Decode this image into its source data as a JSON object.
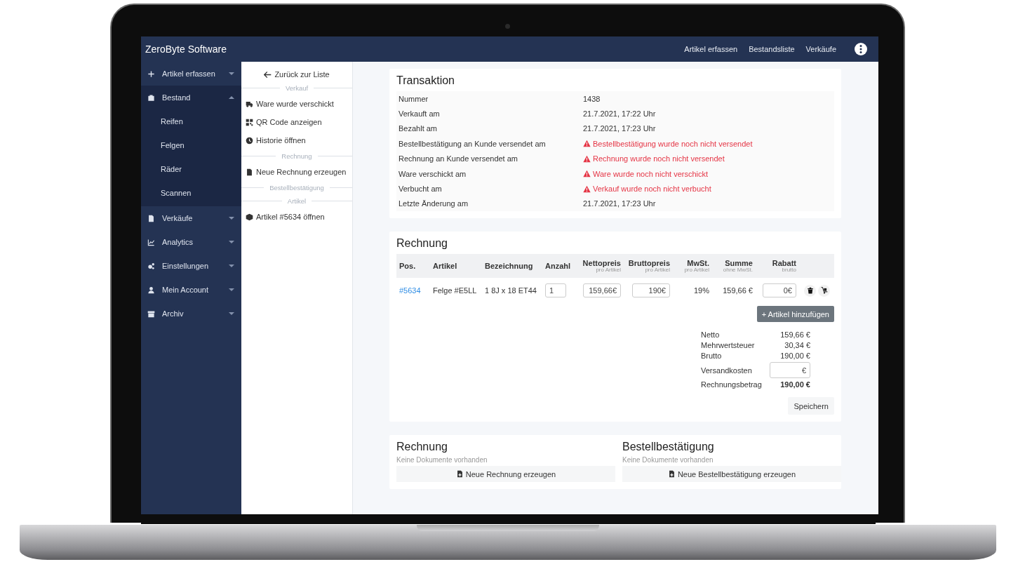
{
  "header": {
    "title": "ZeroByte Software",
    "nav": [
      "Artikel erfassen",
      "Bestandsliste",
      "Verkäufe"
    ]
  },
  "sidebar": {
    "items": [
      {
        "label": "Artikel erfassen",
        "expanded": false
      },
      {
        "label": "Bestand",
        "expanded": true,
        "children": [
          "Reifen",
          "Felgen",
          "Räder",
          "Scannen"
        ]
      },
      {
        "label": "Verkäufe",
        "expanded": false
      },
      {
        "label": "Analytics",
        "expanded": false
      },
      {
        "label": "Einstellungen",
        "expanded": false
      },
      {
        "label": "Mein Account",
        "expanded": false
      },
      {
        "label": "Archiv",
        "expanded": false
      }
    ]
  },
  "actions": {
    "back": "Zurück zur Liste",
    "sections": [
      {
        "heading": "Verkauf",
        "items": [
          "Ware wurde verschickt",
          "QR Code anzeigen",
          "Historie öffnen"
        ]
      },
      {
        "heading": "Rechnung",
        "items": [
          "Neue Rechnung erzeugen"
        ]
      },
      {
        "heading": "Bestellbestätigung"
      },
      {
        "heading": "Artikel",
        "items": [
          "Artikel #5634 öffnen"
        ]
      }
    ]
  },
  "transaction": {
    "title": "Transaktion",
    "rows": [
      {
        "label": "Nummer",
        "value": "1438",
        "warning": false
      },
      {
        "label": "Verkauft am",
        "value": "21.7.2021, 17:22 Uhr",
        "warning": false
      },
      {
        "label": "Bezahlt am",
        "value": "21.7.2021, 17:23 Uhr",
        "warning": false
      },
      {
        "label": "Bestellbestätigung an Kunde versendet am",
        "value": "Bestellbestätigung wurde noch nicht versendet",
        "warning": true
      },
      {
        "label": "Rechnung an Kunde versendet am",
        "value": "Rechnung wurde noch nicht versendet",
        "warning": true
      },
      {
        "label": "Ware verschickt am",
        "value": "Ware wurde noch nicht verschickt",
        "warning": true
      },
      {
        "label": "Verbucht am",
        "value": "Verkauf wurde noch nicht verbucht",
        "warning": true
      },
      {
        "label": "Letzte Änderung am",
        "value": "21.7.2021, 17:23 Uhr",
        "warning": false
      }
    ]
  },
  "invoice": {
    "title": "Rechnung",
    "columns": [
      {
        "label": "Pos."
      },
      {
        "label": "Artikel"
      },
      {
        "label": "Bezeichnung"
      },
      {
        "label": "Anzahl"
      },
      {
        "label": "Nettopreis",
        "sublabel": "pro Artikel"
      },
      {
        "label": "Bruttopreis",
        "sublabel": "pro Artikel"
      },
      {
        "label": "MwSt.",
        "sublabel": "pro Artikel"
      },
      {
        "label": "Summe",
        "sublabel": "ohne MwSt."
      },
      {
        "label": "Rabatt",
        "sublabel": "brutto"
      }
    ],
    "rows": [
      {
        "pos": "#5634",
        "artikel": "Felge #E5LL",
        "bezeichnung": "1 8J x 18 ET44",
        "anzahl": "1",
        "netto": "159,66€",
        "brutto": "190€",
        "mwst": "19%",
        "summe": "159,66 €",
        "rabatt": "0€"
      }
    ],
    "add_button": "+ Artikel hinzufügen",
    "totals": [
      {
        "kind": "line",
        "label": "Netto",
        "value": "159,66 €"
      },
      {
        "kind": "line",
        "label": "Mehrwertsteuer",
        "value": "30,34 €"
      },
      {
        "kind": "line",
        "label": "Brutto",
        "value": "190,00 €"
      },
      {
        "kind": "field",
        "label": "Versandkosten",
        "value": "€"
      },
      {
        "kind": "total",
        "label": "Rechnungsbetrag",
        "value": "190,00 €"
      }
    ],
    "save_button": "Speichern"
  },
  "documents": [
    {
      "title": "Rechnung",
      "note": "Keine Dokumente vorhanden",
      "button": "Neue Rechnung erzeugen"
    },
    {
      "title": "Bestellbestätigung",
      "note": "Keine Dokumente vorhanden",
      "button": "Neue Bestellbestätigung erzeugen"
    }
  ]
}
